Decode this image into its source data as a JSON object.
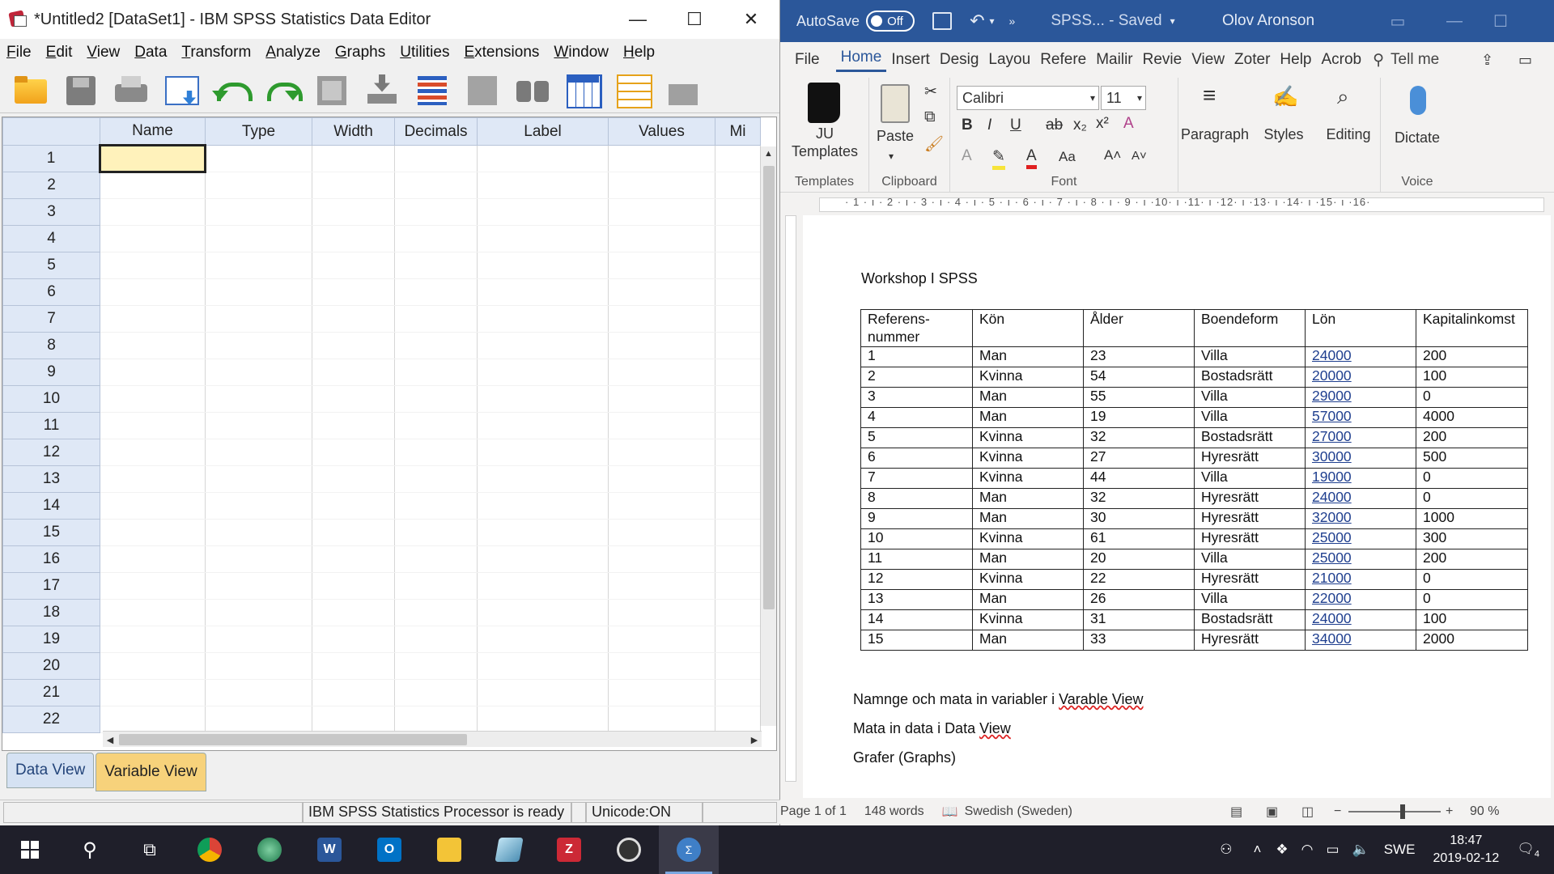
{
  "spss": {
    "title": "*Untitled2 [DataSet1] - IBM SPSS Statistics Data Editor",
    "window_controls": {
      "minimize": "—",
      "maximize": "☐",
      "close": "✕"
    },
    "menu": [
      "File",
      "Edit",
      "View",
      "Data",
      "Transform",
      "Analyze",
      "Graphs",
      "Utilities",
      "Extensions",
      "Window",
      "Help"
    ],
    "columns": [
      "Name",
      "Type",
      "Width",
      "Decimals",
      "Label",
      "Values",
      "Mi"
    ],
    "rows": [
      "1",
      "2",
      "3",
      "4",
      "5",
      "6",
      "7",
      "8",
      "9",
      "10",
      "11",
      "12",
      "13",
      "14",
      "15",
      "16",
      "17",
      "18",
      "19",
      "20",
      "21",
      "22"
    ],
    "tabs": {
      "data_view": "Data View",
      "variable_view": "Variable View"
    },
    "status": {
      "processor": "IBM SPSS Statistics Processor is ready",
      "unicode": "Unicode:ON"
    },
    "icons": [
      "open-folder-icon",
      "save-icon",
      "print-icon",
      "recall-dialog-icon",
      "undo-icon",
      "redo-icon",
      "goto-case-icon",
      "goto-variable-icon",
      "variables-icon",
      "chart-icon",
      "find-icon",
      "insert-cases-icon",
      "insert-variable-icon",
      "scale-icon"
    ]
  },
  "word": {
    "autosave_label": "AutoSave",
    "autosave_state": "Off",
    "doc_title": "SPSS...  -  Saved",
    "user": "Olov Aronson",
    "tabs": [
      "File",
      "Home",
      "Insert",
      "Desig",
      "Layou",
      "Refere",
      "Mailir",
      "Revie",
      "View",
      "Zoter",
      "Help",
      "Acrob"
    ],
    "tell_me": "Tell me",
    "ribbon": {
      "templates_button": "JU\nTemplates",
      "templates_group": "Templates",
      "paste": "Paste",
      "clipboard_group": "Clipboard",
      "font_name": "Calibri",
      "font_size": "11",
      "font_group": "Font",
      "paragraph": "Paragraph",
      "styles": "Styles",
      "editing": "Editing",
      "dictate": "Dictate",
      "voice_group": "Voice"
    },
    "ruler_numbers": "· 1 · ı · 2 · ı · 3 · ı · 4 · ı · 5 · ı · 6 · ı · 7 · ı · 8 · ı · 9 · ı ·10· ı ·11· ı ·12· ı ·13· ı ·14· ı ·15· ı ·16·",
    "document": {
      "heading": "Workshop I SPSS",
      "table_headers": [
        "Referens-\nnummer",
        "Kön",
        "Ålder",
        "Boendeform",
        "Lön",
        "Kapitalinkomst"
      ],
      "table_rows": [
        [
          "1",
          "Man",
          "23",
          "Villa",
          "24000",
          "200"
        ],
        [
          "2",
          "Kvinna",
          "54",
          "Bostadsrätt",
          "20000",
          "100"
        ],
        [
          "3",
          "Man",
          "55",
          "Villa",
          "29000",
          "0"
        ],
        [
          "4",
          "Man",
          "19",
          "Villa",
          "57000",
          "4000"
        ],
        [
          "5",
          "Kvinna",
          "32",
          "Bostadsrätt",
          "27000",
          "200"
        ],
        [
          "6",
          "Kvinna",
          "27",
          "Hyresrätt",
          "30000",
          "500"
        ],
        [
          "7",
          "Kvinna",
          "44",
          "Villa",
          "19000",
          "0"
        ],
        [
          "8",
          "Man",
          "32",
          "Hyresrätt",
          "24000",
          "0"
        ],
        [
          "9",
          "Man",
          "30",
          "Hyresrätt",
          "32000",
          "1000"
        ],
        [
          "10",
          "Kvinna",
          "61",
          "Hyresrätt",
          "25000",
          "300"
        ],
        [
          "11",
          "Man",
          "20",
          "Villa",
          "25000",
          "200"
        ],
        [
          "12",
          "Kvinna",
          "22",
          "Hyresrätt",
          "21000",
          "0"
        ],
        [
          "13",
          "Man",
          "26",
          "Villa",
          "22000",
          "0"
        ],
        [
          "14",
          "Kvinna",
          "31",
          "Bostadsrätt",
          "24000",
          "100"
        ],
        [
          "15",
          "Man",
          "33",
          "Hyresrätt",
          "34000",
          "2000"
        ]
      ],
      "instruction1_prefix": "Namnge och mata in variabler i ",
      "instruction1_link": "Varable View",
      "instruction2_prefix": "Mata in data i Data ",
      "instruction2_link": "View",
      "instruction3": "Grafer (Graphs)"
    },
    "status": {
      "page": "Page 1 of 1",
      "words": "148 words",
      "language": "Swedish (Sweden)",
      "zoom": "90 %"
    }
  },
  "taskbar": {
    "apps": [
      "search-icon",
      "task-view-icon",
      "chrome-icon",
      "globe-app-icon",
      "word-icon",
      "outlook-icon",
      "file-explorer-icon",
      "notes-app-icon",
      "zotero-icon",
      "obs-icon",
      "spss-icon"
    ],
    "language": "SWE",
    "time": "18:47",
    "date": "2019-02-12",
    "notifications": "4"
  }
}
